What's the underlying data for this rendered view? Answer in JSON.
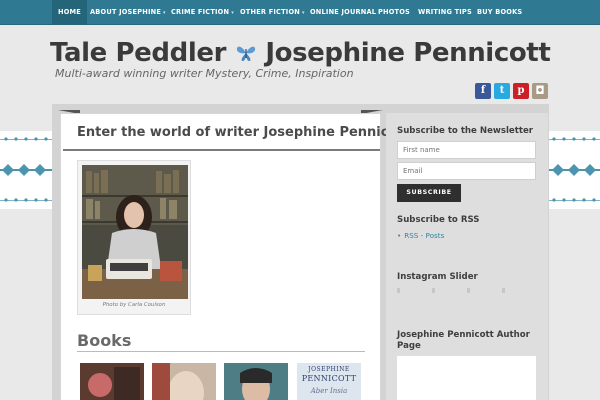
{
  "nav": {
    "items": [
      {
        "label": "HOME",
        "active": true,
        "dropdown": false
      },
      {
        "label": "ABOUT JOSEPHINE",
        "dropdown": true
      },
      {
        "label": "CRIME FICTION",
        "dropdown": true
      },
      {
        "label": "OTHER FICTION",
        "dropdown": true
      },
      {
        "label": "ONLINE JOURNAL",
        "dropdown": false
      },
      {
        "label": "PHOTOS",
        "dropdown": false
      },
      {
        "label": "WRITING TIPS",
        "dropdown": false
      },
      {
        "label": "BUY BOOKS",
        "dropdown": false
      }
    ],
    "caret": "▾"
  },
  "header": {
    "title_left": "Tale Peddler",
    "title_right": "Josephine Pennicott",
    "tagline": "Multi-award winning writer Mystery, Crime, Inspiration",
    "social": [
      {
        "name": "facebook",
        "glyph": "f",
        "color": "#3b5998"
      },
      {
        "name": "twitter",
        "glyph": "t",
        "color": "#2aa9e0"
      },
      {
        "name": "pinterest",
        "glyph": "p",
        "color": "#cb2027"
      },
      {
        "name": "instagram",
        "glyph": "◘",
        "color": "#a89a85"
      }
    ]
  },
  "content": {
    "title": "Enter the world of writer Josephine Pennicott",
    "photo_caption": "Photo by Carla Coulson",
    "books_heading": "Books"
  },
  "sidebar": {
    "newsletter_heading": "Subscribe to the Newsletter",
    "first_name_placeholder": "First name",
    "email_placeholder": "Email",
    "subscribe_label": "SUBSCRIBE",
    "rss_heading": "Subscribe to RSS",
    "rss_link": "RSS - Posts",
    "instagram_heading": "Instagram Slider",
    "author_page_heading": "Josephine Pennicott Author Page"
  },
  "book_cover": {
    "author_top": "JOSEPHINE",
    "author_bottom": "PENNICOTT",
    "script_text": "Aber Insia"
  },
  "colors": {
    "nav_bg": "#2f7a92",
    "accent_teal": "#2f86a6",
    "butterfly": "#5b9bd5"
  }
}
